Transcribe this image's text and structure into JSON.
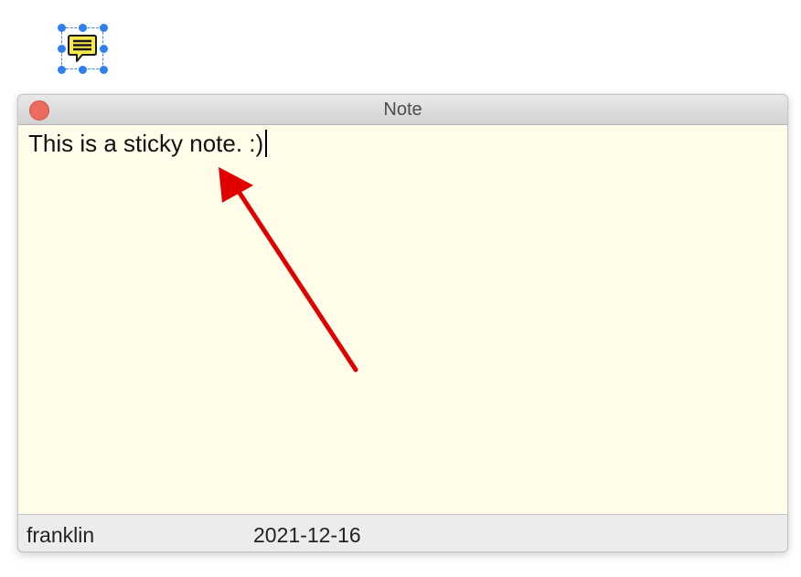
{
  "annotation": {
    "icon": "speech-bubble-note-icon",
    "selected": true,
    "selection_color": "#2f7ff0",
    "fill_color": "#f7e94e"
  },
  "note_window": {
    "title": "Note",
    "close_color": "#ec6a5e",
    "text": "This is a sticky note. :)",
    "background_color": "#fffdea",
    "author": "franklin",
    "date": "2021-12-16"
  },
  "callout": {
    "icon": "red-arrow-icon",
    "color": "#e00000"
  }
}
